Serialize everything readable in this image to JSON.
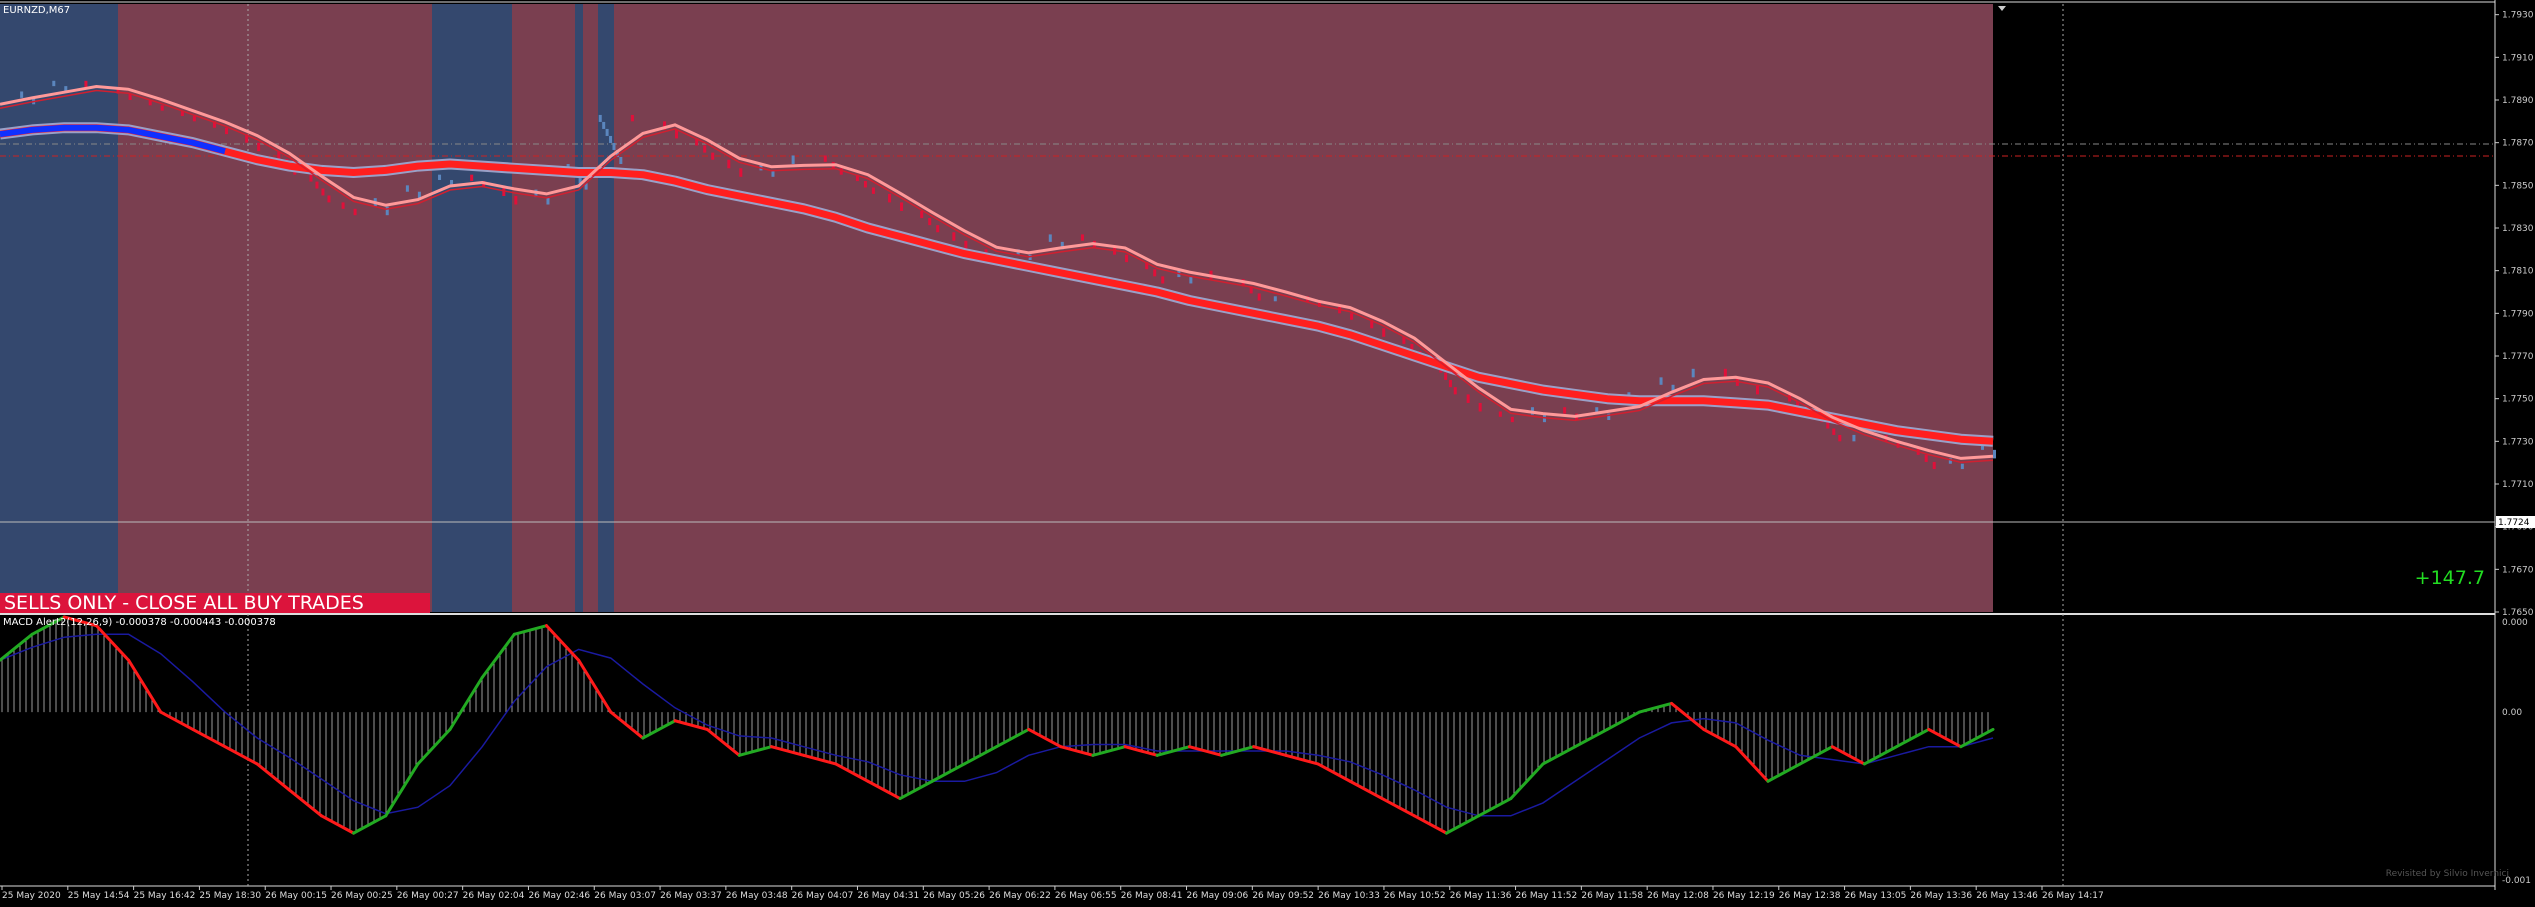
{
  "chart": {
    "symbol_label": "EURNZD,M67",
    "banner": "SELLS ONLY - CLOSE ALL BUY TRADES",
    "profit": "+147.7",
    "current_price_label": "1.7724"
  },
  "macd": {
    "label": "MACD Alert2(12,26,9) -0.000378 -0.000443 -0.000378"
  },
  "price_axis": [
    "1.7930",
    "1.7910",
    "1.7890",
    "1.7870",
    "1.7850",
    "1.7830",
    "1.7810",
    "1.7790",
    "1.7770",
    "1.7750",
    "1.7730",
    "1.7710",
    "1.7690",
    "1.7670",
    "1.7650"
  ],
  "macd_axis": [
    "0.000",
    "0.00",
    "-0.001"
  ],
  "time_axis": [
    "25 May 2020",
    "25 May 14:54",
    "25 May 16:42",
    "25 May 18:30",
    "26 May 00:15",
    "26 May 00:25",
    "26 May 00:27",
    "26 May 02:04",
    "26 May 02:46",
    "26 May 03:07",
    "26 May 03:37",
    "26 May 03:48",
    "26 May 04:07",
    "26 May 04:31",
    "26 May 05:26",
    "26 May 06:22",
    "26 May 06:55",
    "26 May 08:41",
    "26 May 09:06",
    "26 May 09:52",
    "26 May 10:33",
    "26 May 10:52",
    "26 May 11:36",
    "26 May 11:52",
    "26 May 11:58",
    "26 May 12:08",
    "26 May 12:19",
    "26 May 12:38",
    "26 May 13:05",
    "26 May 13:36",
    "26 May 13:46",
    "26 May 14:17"
  ],
  "watermark": "Revisited by Silvio Invernici",
  "colors": {
    "bear_zone": "#7a3f50",
    "bull_zone": "#34486e",
    "bear_candle": "#e0103a",
    "bull_candle": "#5b86be",
    "slow_ma": "#ff1f1f",
    "fast_ma_bull": "#1030ff",
    "macd_up": "#22aa22",
    "macd_down": "#ff1a1a",
    "signal": "#1a1aa0",
    "histogram": "#9a9a9a"
  },
  "chart_data": {
    "type": "line",
    "x_start": "25 May 2020",
    "x_end": "26 May 14:17",
    "price": [
      1.7888,
      1.7894,
      1.7899,
      1.7896,
      1.789,
      1.7885,
      1.788,
      1.7874,
      1.7866,
      1.7855,
      1.7842,
      1.7836,
      1.7844,
      1.785,
      1.7855,
      1.7849,
      1.7841,
      1.7848,
      1.786,
      1.7883,
      1.788,
      1.7872,
      1.7862,
      1.7854,
      1.786,
      1.7864,
      1.7855,
      1.7846,
      1.7838,
      1.7828,
      1.782,
      1.7815,
      1.782,
      1.7827,
      1.7821,
      1.7814,
      1.7804,
      1.781,
      1.7806,
      1.7796,
      1.7798,
      1.7793,
      1.7787,
      1.7779,
      1.7769,
      1.7752,
      1.7744,
      1.7739,
      1.7746,
      1.774,
      1.7746,
      1.7753,
      1.776,
      1.7764,
      1.7756,
      1.7752,
      1.7742,
      1.773,
      1.7733,
      1.7727,
      1.7717,
      1.7722,
      1.773
    ],
    "slow_ma": [
      1.7874,
      1.7876,
      1.7877,
      1.7877,
      1.7876,
      1.7873,
      1.787,
      1.7866,
      1.7862,
      1.7859,
      1.7857,
      1.7856,
      1.7857,
      1.7859,
      1.786,
      1.7859,
      1.7858,
      1.7857,
      1.7856,
      1.7856,
      1.7855,
      1.7852,
      1.7848,
      1.7845,
      1.7842,
      1.7839,
      1.7835,
      1.783,
      1.7826,
      1.7822,
      1.7818,
      1.7815,
      1.7812,
      1.7809,
      1.7806,
      1.7803,
      1.78,
      1.7796,
      1.7793,
      1.779,
      1.7787,
      1.7784,
      1.778,
      1.7775,
      1.777,
      1.7765,
      1.776,
      1.7757,
      1.7754,
      1.7752,
      1.775,
      1.7749,
      1.7749,
      1.7749,
      1.7748,
      1.7747,
      1.7744,
      1.7741,
      1.7738,
      1.7735,
      1.7733,
      1.7731,
      1.773
    ],
    "macd": [
      0.0003,
      0.00045,
      0.00055,
      0.0005,
      0.0003,
      0.0,
      -0.0001,
      -0.0002,
      -0.0003,
      -0.00045,
      -0.0006,
      -0.0007,
      -0.0006,
      -0.0003,
      -0.0001,
      0.0002,
      0.00045,
      0.0005,
      0.0003,
      0.0,
      -0.00015,
      -5e-05,
      -0.0001,
      -0.00025,
      -0.0002,
      -0.00025,
      -0.0003,
      -0.0004,
      -0.0005,
      -0.0004,
      -0.0003,
      -0.0002,
      -0.0001,
      -0.0002,
      -0.00025,
      -0.0002,
      -0.00025,
      -0.0002,
      -0.00025,
      -0.0002,
      -0.00025,
      -0.0003,
      -0.0004,
      -0.0005,
      -0.0006,
      -0.0007,
      -0.0006,
      -0.0005,
      -0.0003,
      -0.0002,
      -0.0001,
      0.0,
      5e-05,
      -0.0001,
      -0.0002,
      -0.0004,
      -0.0003,
      -0.0002,
      -0.0003,
      -0.0002,
      -0.0001,
      -0.0002,
      -0.0001
    ],
    "ylim_price": [
      1.765,
      1.7935
    ],
    "ylim_macd": [
      -0.001,
      0.00055
    ]
  }
}
